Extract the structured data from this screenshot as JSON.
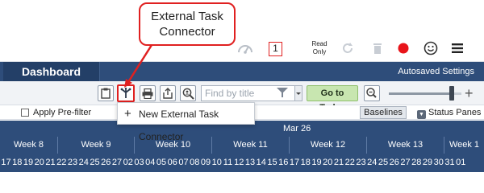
{
  "callout": {
    "text_line1": "External Task",
    "text_line2": "Connector"
  },
  "topbar": {
    "page_number": "1",
    "read_only_line1": "Read",
    "read_only_line2": "Only",
    "colors": {
      "record": "#e8141a"
    }
  },
  "dashboard": {
    "tab_label": "Dashboard",
    "autosave_label": "Autosaved Settings"
  },
  "toolbar": {
    "search_placeholder": "Find by title",
    "goto_today_label": "Go to Today",
    "zoom_level": 0.87,
    "icons": [
      "clipboard-icon",
      "external-task-connector-icon",
      "print-icon",
      "share-icon",
      "search-user-icon",
      "filter-icon",
      "zoom-minus-icon",
      "zoom-plus-icon"
    ]
  },
  "filterrow": {
    "prefilter_label": "Apply Pre-filter",
    "baselines_label": "Baselines",
    "status_panes_label": "Status Panes"
  },
  "menu": {
    "items": [
      {
        "label": "New External Task Connector"
      }
    ]
  },
  "timeline": {
    "month_label": "Mar 26",
    "weeks": [
      "Week 8",
      "Week 9",
      "Week 10",
      "Week 11",
      "Week 12",
      "Week 13",
      "Week 1"
    ],
    "days": [
      "17",
      "18",
      "19",
      "20",
      "21",
      "22",
      "23",
      "24",
      "25",
      "26",
      "27",
      "02",
      "03",
      "04",
      "05",
      "06",
      "07",
      "08",
      "09",
      "10",
      "11",
      "12",
      "13",
      "14",
      "15",
      "16",
      "17",
      "18",
      "19",
      "20",
      "21",
      "22",
      "23",
      "24",
      "25",
      "26",
      "27",
      "28",
      "29",
      "30",
      "31",
      "01"
    ]
  }
}
